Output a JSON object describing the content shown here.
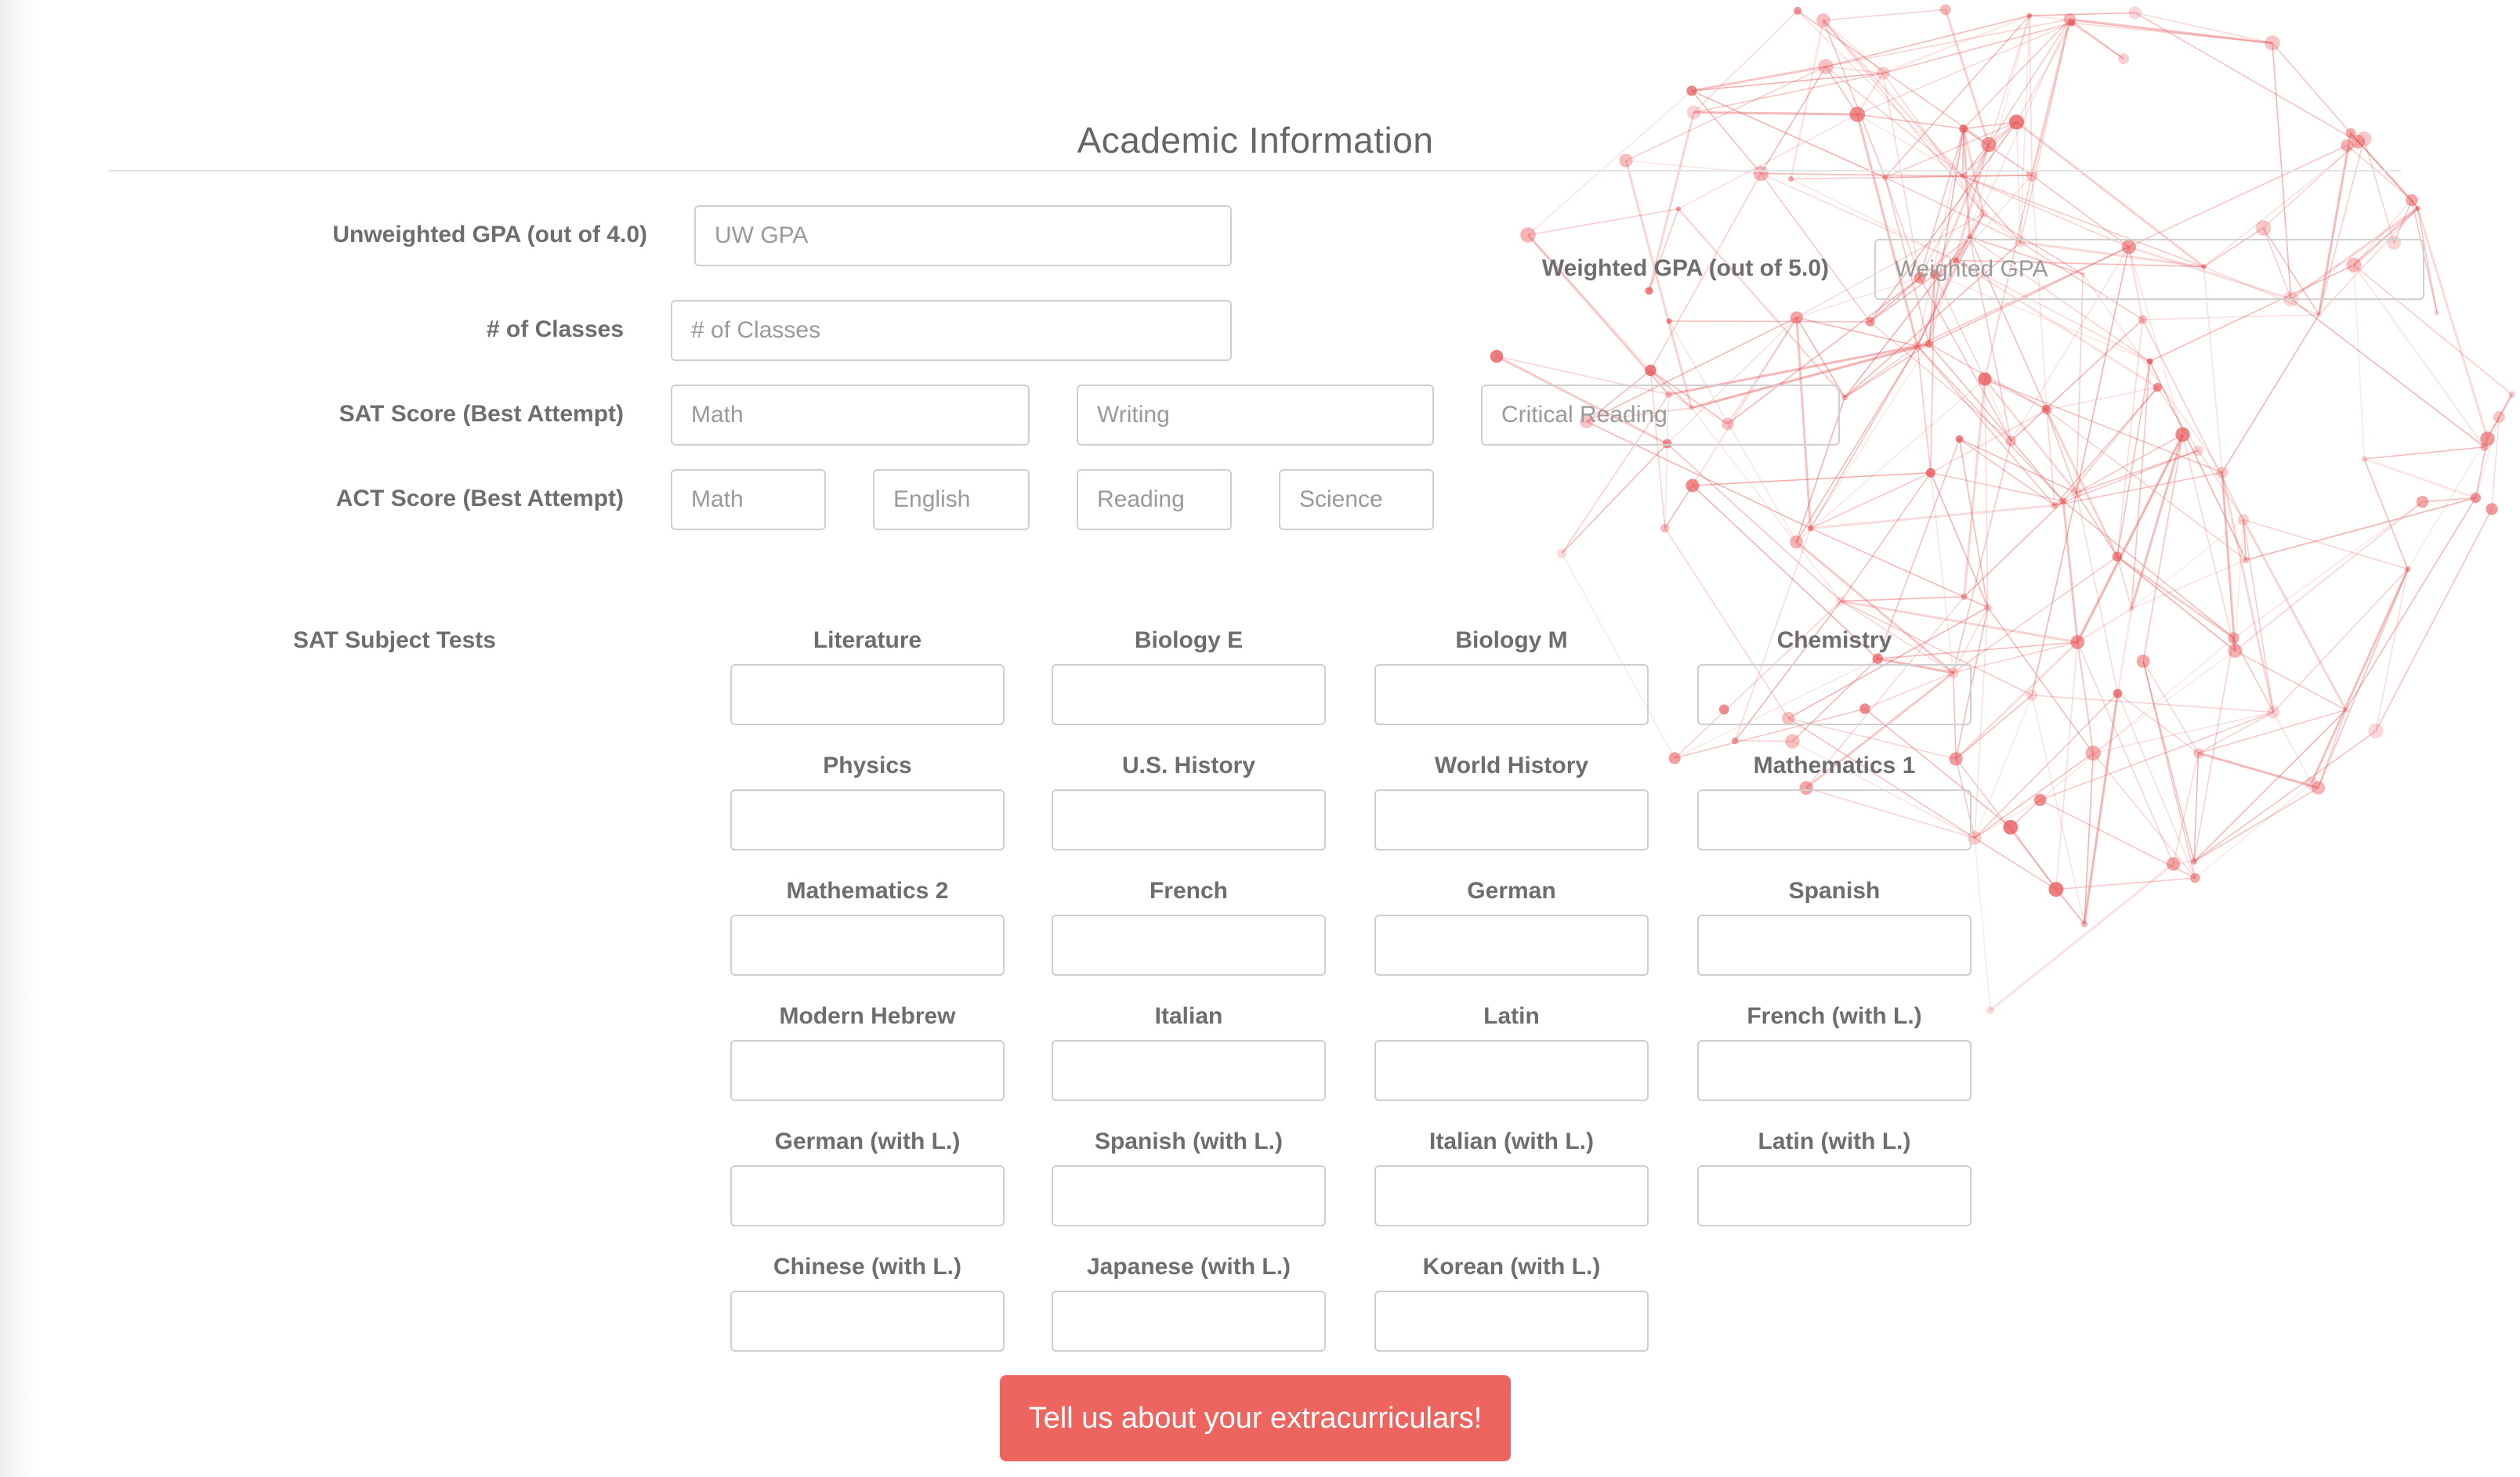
{
  "section_title": "Academic Information",
  "gpa": {
    "unweighted_label": "Unweighted GPA (out of 4.0)",
    "unweighted_placeholder": "UW GPA",
    "weighted_label": "Weighted GPA (out of 5.0)",
    "weighted_placeholder": "Weighted GPA"
  },
  "classes": {
    "label": "# of Classes",
    "placeholder": "# of Classes"
  },
  "sat": {
    "label": "SAT Score (Best Attempt)",
    "math_placeholder": "Math",
    "writing_placeholder": "Writing",
    "reading_placeholder": "Critical Reading"
  },
  "act": {
    "label": "ACT Score (Best Attempt)",
    "math_placeholder": "Math",
    "english_placeholder": "English",
    "reading_placeholder": "Reading",
    "science_placeholder": "Science"
  },
  "subject_tests": {
    "label": "SAT Subject Tests",
    "items": [
      "Literature",
      "Biology E",
      "Biology M",
      "Chemistry",
      "Physics",
      "U.S. History",
      "World History",
      "Mathematics 1",
      "Mathematics 2",
      "French",
      "German",
      "Spanish",
      "Modern Hebrew",
      "Italian",
      "Latin",
      "French (with L.)",
      "German (with L.)",
      "Spanish (with L.)",
      "Italian (with L.)",
      "Latin (with L.)",
      "Chinese (with L.)",
      "Japanese (with L.)",
      "Korean (with L.)"
    ]
  },
  "cta_label": "Tell us about your extracurriculars!",
  "colors": {
    "accent": "#ee6560",
    "network": "#e8575a"
  }
}
